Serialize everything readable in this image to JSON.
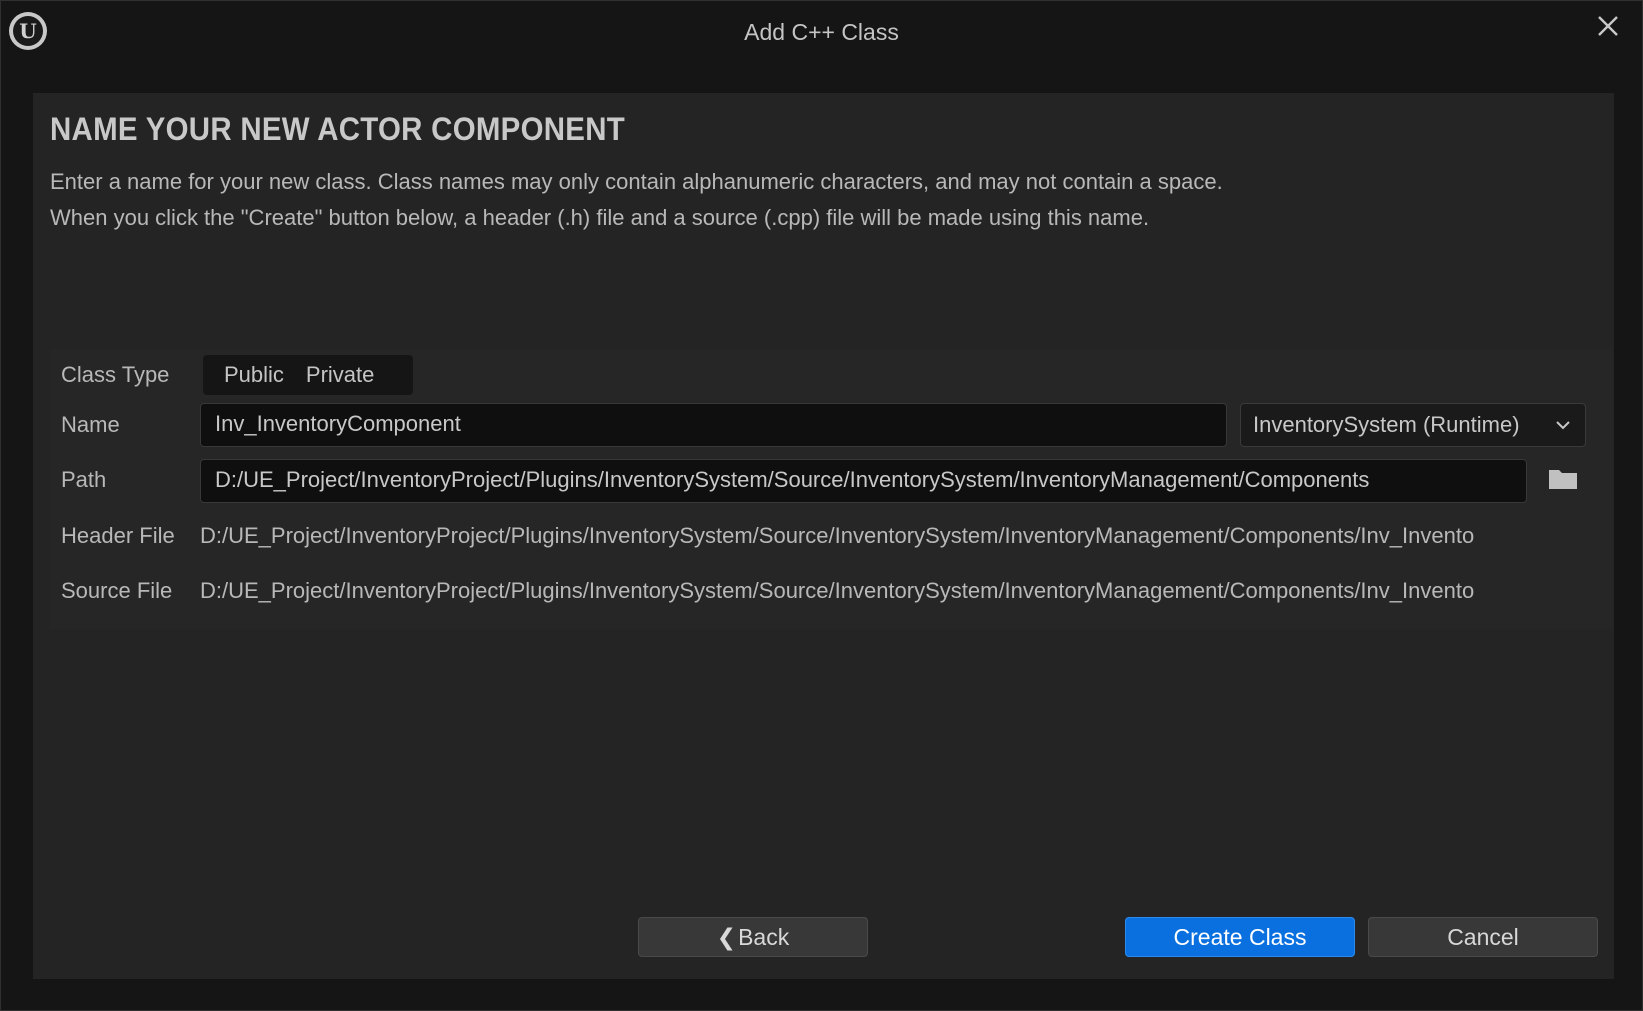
{
  "window": {
    "title": "Add C++ Class",
    "logo_icon": "unreal-engine-logo",
    "logo_glyph": "U",
    "close_icon": "close-icon"
  },
  "main": {
    "heading": "NAME YOUR NEW ACTOR COMPONENT",
    "description_line1": "Enter a name for your new class. Class names may only contain alphanumeric characters, and may not contain a space.",
    "description_line2": "When you click the \"Create\" button below, a header (.h) file and a source (.cpp) file will be made using this name."
  },
  "form": {
    "class_type_label": "Class Type",
    "class_type_options": [
      "Public",
      "Private"
    ],
    "name_label": "Name",
    "name_value": "Inv_InventoryComponent",
    "module_value": "InventorySystem (Runtime)",
    "path_label": "Path",
    "path_value": "D:/UE_Project/InventoryProject/Plugins/InventorySystem/Source/InventorySystem/InventoryManagement/Components",
    "header_file_label": "Header File",
    "header_file_value": "D:/UE_Project/InventoryProject/Plugins/InventorySystem/Source/InventorySystem/InventoryManagement/Components/Inv_Invento",
    "source_file_label": "Source File",
    "source_file_value": "D:/UE_Project/InventoryProject/Plugins/InventorySystem/Source/InventorySystem/InventoryManagement/Components/Inv_Invento"
  },
  "footer": {
    "back_label": "Back",
    "create_label": "Create Class",
    "cancel_label": "Cancel"
  },
  "colors": {
    "accent": "#0a70e0",
    "background": "#151515",
    "panel": "#242424"
  }
}
